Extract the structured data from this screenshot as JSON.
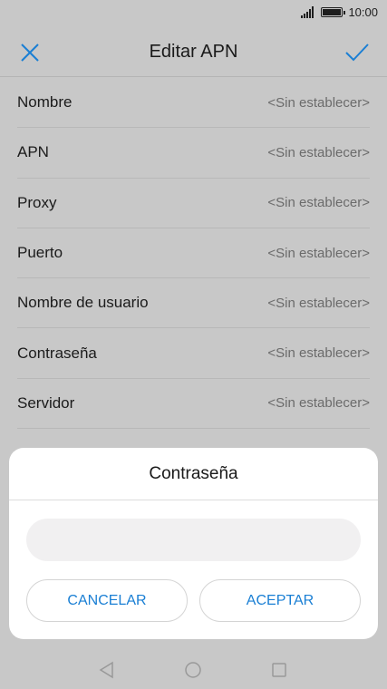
{
  "status_bar": {
    "time": "10:00"
  },
  "header": {
    "title": "Editar APN"
  },
  "settings": [
    {
      "label": "Nombre",
      "value": "<Sin establecer>"
    },
    {
      "label": "APN",
      "value": "<Sin establecer>"
    },
    {
      "label": "Proxy",
      "value": "<Sin establecer>"
    },
    {
      "label": "Puerto",
      "value": "<Sin establecer>"
    },
    {
      "label": "Nombre de usuario",
      "value": "<Sin establecer>"
    },
    {
      "label": "Contraseña",
      "value": "<Sin establecer>"
    },
    {
      "label": "Servidor",
      "value": "<Sin establecer>"
    }
  ],
  "dialog": {
    "title": "Contraseña",
    "input_value": "",
    "cancel_label": "CANCELAR",
    "accept_label": "ACEPTAR"
  },
  "colors": {
    "accent": "#1a7fd4",
    "background": "#c8c8c8",
    "dialog_bg": "#ffffff"
  },
  "icons": {
    "close": "close-icon",
    "check": "check-icon",
    "back": "back-triangle-icon",
    "home": "home-circle-icon",
    "recents": "recents-square-icon"
  }
}
